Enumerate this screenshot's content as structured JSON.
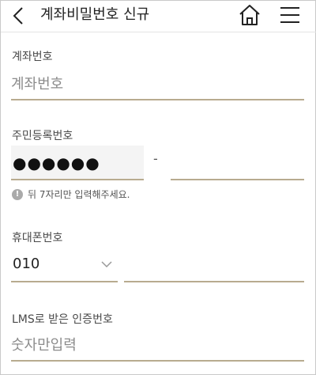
{
  "header": {
    "title": "계좌비밀번호 신규"
  },
  "account": {
    "label": "계좌번호",
    "placeholder": "계좌번호"
  },
  "resident": {
    "label": "주민등록번호",
    "front_masked": "●●●●●●",
    "dash": "-",
    "back_value": "",
    "hint": "뒤 7자리만 입력해주세요."
  },
  "phone": {
    "label": "휴대폰번호",
    "prefix_selected": "010",
    "number_value": ""
  },
  "lms": {
    "label": "LMS로 받은 인증번호",
    "placeholder": "숫자만입력"
  },
  "colors": {
    "underline": "#b8ab8f",
    "hint_icon": "#aaaaaa"
  },
  "icons": [
    "chevron-left-icon",
    "home-icon",
    "hamburger-menu-icon",
    "info-icon",
    "chevron-down-icon"
  ]
}
